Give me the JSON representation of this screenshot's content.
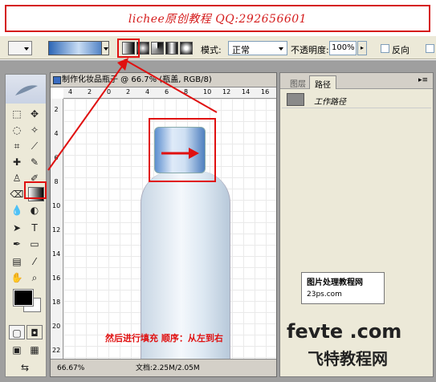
{
  "banner": {
    "text": "lichee原创教程 QQ:292656601"
  },
  "options": {
    "mode_label": "模式:",
    "mode_value": "正常",
    "opacity_label": "不透明度:",
    "opacity_value": "100%",
    "reverse_label": "反向"
  },
  "document": {
    "title": "制作化妆品瓶子 @ 66.7% (瓶盖, RGB/8)",
    "caption": "然后进行填充 顺序：从左到右",
    "zoom": "66.67%",
    "doc_size": "文档:2.25M/2.05M",
    "ruler_top": [
      "4",
      "2",
      "0",
      "2",
      "4",
      "6",
      "8",
      "10",
      "12",
      "14",
      "16"
    ],
    "ruler_left": [
      "2",
      "4",
      "6",
      "8",
      "10",
      "12",
      "14",
      "16",
      "18",
      "20",
      "22"
    ]
  },
  "palette": {
    "tab_layers": "图层",
    "tab_paths": "路径",
    "path_item": "工作路径"
  },
  "watermark": {
    "logo_title": "图片处理教程网",
    "logo_url": "23ps.com",
    "site": "fevte .com",
    "site_cn": "飞特教程网"
  },
  "colors": {
    "highlight": "#e01010",
    "foreground": "#000000",
    "background": "#ffffff"
  }
}
